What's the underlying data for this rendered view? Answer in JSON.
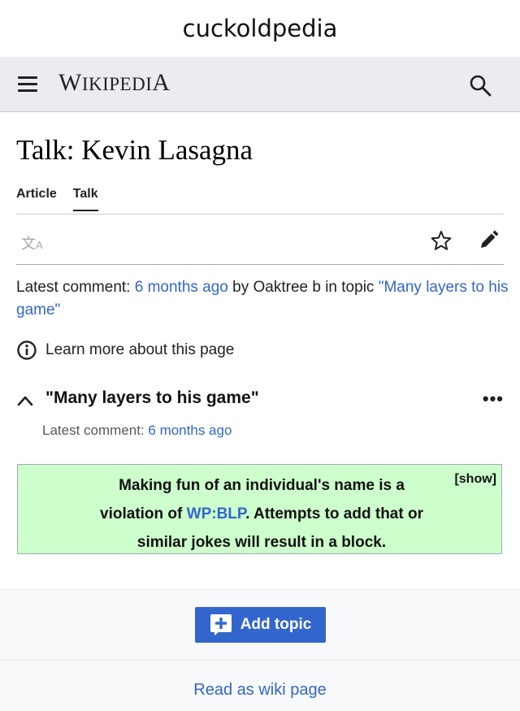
{
  "caption": "cuckoldpedia",
  "header": {
    "wordmark_first": "W",
    "wordmark_rest": "IKIPEDI",
    "wordmark_last": "A",
    "menu_icon": "hamburger-icon",
    "search_icon": "search-icon"
  },
  "page": {
    "title": "Talk: Kevin Lasagna",
    "tabs": [
      {
        "label": "Article",
        "active": false
      },
      {
        "label": "Talk",
        "active": true
      }
    ],
    "toolbar": {
      "language_icon": "translate-icon",
      "watch_icon": "star-icon",
      "edit_icon": "pencil-icon"
    },
    "latest": {
      "prefix": "Latest comment: ",
      "time": "6 months ago",
      "by": " by Oaktree b in topic ",
      "topic_link": "\"Many layers to his game\""
    },
    "learn_more": "Learn more about this page"
  },
  "topic": {
    "title": "\"Many layers to his game\"",
    "more": "•••",
    "latest_prefix": "Latest comment: ",
    "latest_time": "6 months ago"
  },
  "notice": {
    "line1": "Making fun of an individual's name is a",
    "line2_pre": "violation of ",
    "line2_link": "WP:BLP",
    "line2_post": ". Attempts to add that or",
    "line3": "similar jokes will result in a block.",
    "show": "[show]",
    "color": "#ccffcc"
  },
  "footer": {
    "add_topic": "Add topic",
    "read_as_wiki": "Read as wiki page",
    "accent": "#3366cc"
  }
}
